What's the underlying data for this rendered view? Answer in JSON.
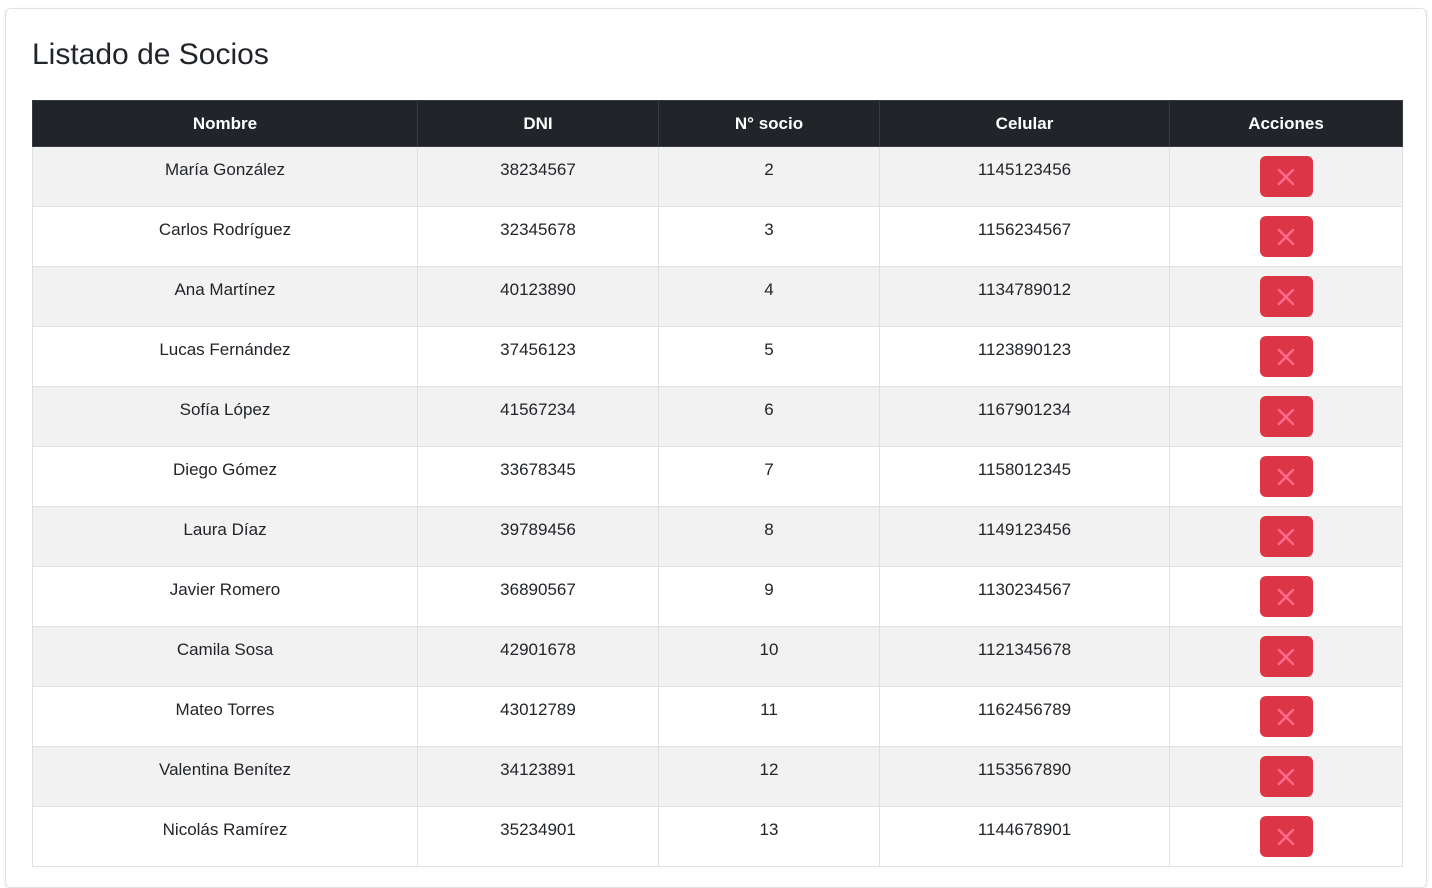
{
  "page": {
    "title": "Listado de Socios"
  },
  "table": {
    "headers": [
      "Nombre",
      "DNI",
      "N° socio",
      "Celular",
      "Acciones"
    ],
    "rows": [
      {
        "nombre": "María González",
        "dni": "38234567",
        "socio": "2",
        "celular": "1145123456"
      },
      {
        "nombre": "Carlos Rodríguez",
        "dni": "32345678",
        "socio": "3",
        "celular": "1156234567"
      },
      {
        "nombre": "Ana Martínez",
        "dni": "40123890",
        "socio": "4",
        "celular": "1134789012"
      },
      {
        "nombre": "Lucas Fernández",
        "dni": "37456123",
        "socio": "5",
        "celular": "1123890123"
      },
      {
        "nombre": "Sofía López",
        "dni": "41567234",
        "socio": "6",
        "celular": "1167901234"
      },
      {
        "nombre": "Diego Gómez",
        "dni": "33678345",
        "socio": "7",
        "celular": "1158012345"
      },
      {
        "nombre": "Laura Díaz",
        "dni": "39789456",
        "socio": "8",
        "celular": "1149123456"
      },
      {
        "nombre": "Javier Romero",
        "dni": "36890567",
        "socio": "9",
        "celular": "1130234567"
      },
      {
        "nombre": "Camila Sosa",
        "dni": "42901678",
        "socio": "10",
        "celular": "1121345678"
      },
      {
        "nombre": "Mateo Torres",
        "dni": "43012789",
        "socio": "11",
        "celular": "1162456789"
      },
      {
        "nombre": "Valentina Benítez",
        "dni": "34123891",
        "socio": "12",
        "celular": "1153567890"
      },
      {
        "nombre": "Nicolás Ramírez",
        "dni": "35234901",
        "socio": "13",
        "celular": "1144678901"
      }
    ]
  },
  "actions": {
    "delete_icon": "close-icon"
  },
  "colors": {
    "header_bg": "#212529",
    "delete_button": "#dc3545",
    "delete_icon": "#ff6b8a",
    "row_stripe": "#f2f2f2"
  }
}
